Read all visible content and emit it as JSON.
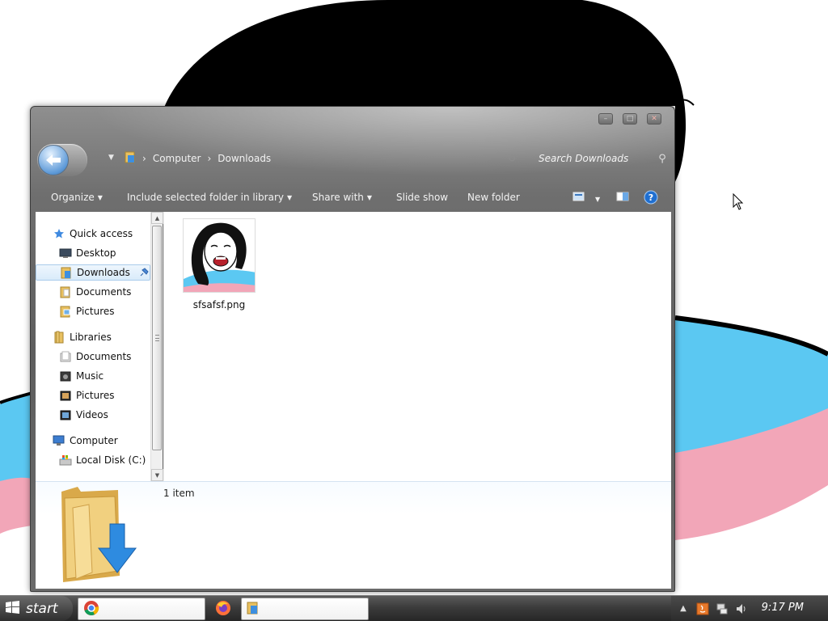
{
  "window": {
    "breadcrumb": [
      "Computer",
      "Downloads"
    ],
    "search_placeholder": "Search Downloads",
    "caption_buttons": [
      "minimize-icon",
      "maximize-icon",
      "close-icon"
    ]
  },
  "commands": {
    "organize": "Organize",
    "include": "Include selected folder in library",
    "share": "Share with",
    "slideshow": "Slide show",
    "new_folder": "New folder"
  },
  "nav": {
    "quick_access": "Quick access",
    "desktop": "Desktop",
    "downloads": "Downloads",
    "documents": "Documents",
    "pictures": "Pictures",
    "libraries": "Libraries",
    "lib_documents": "Documents",
    "lib_music": "Music",
    "lib_pictures": "Pictures",
    "lib_videos": "Videos",
    "computer": "Computer",
    "local_disk": "Local Disk (C:)"
  },
  "files": [
    {
      "name": "sfsafsf.png",
      "icon": "png-thumbnail"
    }
  ],
  "details": {
    "item_count": "1 item"
  },
  "taskbar": {
    "start_label": "start",
    "clock": "9:17 PM",
    "apps": [
      "chrome-icon",
      "firefox-icon",
      "explorer-icon"
    ]
  },
  "colors": {
    "wallpaper_blue": "#5bc8f2",
    "wallpaper_pink": "#f2a6b8",
    "selection": "#d9ebfa",
    "help": "#1f6fd1"
  }
}
